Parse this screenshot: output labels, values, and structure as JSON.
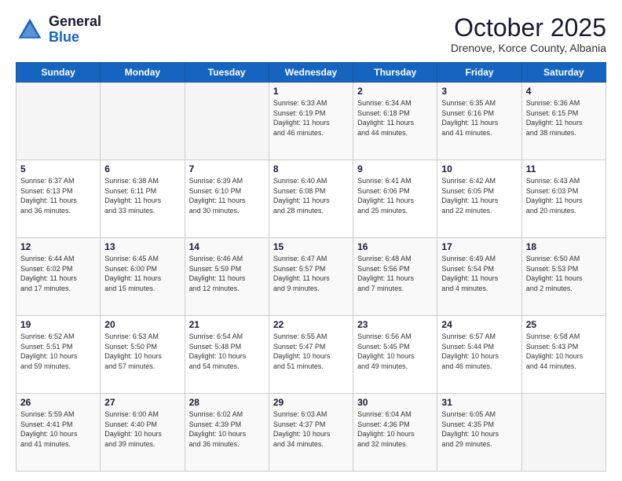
{
  "logo": {
    "general": "General",
    "blue": "Blue"
  },
  "title": "October 2025",
  "subtitle": "Drenove, Korce County, Albania",
  "weekdays": [
    "Sunday",
    "Monday",
    "Tuesday",
    "Wednesday",
    "Thursday",
    "Friday",
    "Saturday"
  ],
  "weeks": [
    [
      {
        "day": "",
        "info": ""
      },
      {
        "day": "",
        "info": ""
      },
      {
        "day": "",
        "info": ""
      },
      {
        "day": "1",
        "info": "Sunrise: 6:33 AM\nSunset: 6:19 PM\nDaylight: 11 hours\nand 46 minutes."
      },
      {
        "day": "2",
        "info": "Sunrise: 6:34 AM\nSunset: 6:18 PM\nDaylight: 11 hours\nand 44 minutes."
      },
      {
        "day": "3",
        "info": "Sunrise: 6:35 AM\nSunset: 6:16 PM\nDaylight: 11 hours\nand 41 minutes."
      },
      {
        "day": "4",
        "info": "Sunrise: 6:36 AM\nSunset: 6:15 PM\nDaylight: 11 hours\nand 38 minutes."
      }
    ],
    [
      {
        "day": "5",
        "info": "Sunrise: 6:37 AM\nSunset: 6:13 PM\nDaylight: 11 hours\nand 36 minutes."
      },
      {
        "day": "6",
        "info": "Sunrise: 6:38 AM\nSunset: 6:11 PM\nDaylight: 11 hours\nand 33 minutes."
      },
      {
        "day": "7",
        "info": "Sunrise: 6:39 AM\nSunset: 6:10 PM\nDaylight: 11 hours\nand 30 minutes."
      },
      {
        "day": "8",
        "info": "Sunrise: 6:40 AM\nSunset: 6:08 PM\nDaylight: 11 hours\nand 28 minutes."
      },
      {
        "day": "9",
        "info": "Sunrise: 6:41 AM\nSunset: 6:06 PM\nDaylight: 11 hours\nand 25 minutes."
      },
      {
        "day": "10",
        "info": "Sunrise: 6:42 AM\nSunset: 6:05 PM\nDaylight: 11 hours\nand 22 minutes."
      },
      {
        "day": "11",
        "info": "Sunrise: 6:43 AM\nSunset: 6:03 PM\nDaylight: 11 hours\nand 20 minutes."
      }
    ],
    [
      {
        "day": "12",
        "info": "Sunrise: 6:44 AM\nSunset: 6:02 PM\nDaylight: 11 hours\nand 17 minutes."
      },
      {
        "day": "13",
        "info": "Sunrise: 6:45 AM\nSunset: 6:00 PM\nDaylight: 11 hours\nand 15 minutes."
      },
      {
        "day": "14",
        "info": "Sunrise: 6:46 AM\nSunset: 5:59 PM\nDaylight: 11 hours\nand 12 minutes."
      },
      {
        "day": "15",
        "info": "Sunrise: 6:47 AM\nSunset: 5:57 PM\nDaylight: 11 hours\nand 9 minutes."
      },
      {
        "day": "16",
        "info": "Sunrise: 6:48 AM\nSunset: 5:56 PM\nDaylight: 11 hours\nand 7 minutes."
      },
      {
        "day": "17",
        "info": "Sunrise: 6:49 AM\nSunset: 5:54 PM\nDaylight: 11 hours\nand 4 minutes."
      },
      {
        "day": "18",
        "info": "Sunrise: 6:50 AM\nSunset: 5:53 PM\nDaylight: 11 hours\nand 2 minutes."
      }
    ],
    [
      {
        "day": "19",
        "info": "Sunrise: 6:52 AM\nSunset: 5:51 PM\nDaylight: 10 hours\nand 59 minutes."
      },
      {
        "day": "20",
        "info": "Sunrise: 6:53 AM\nSunset: 5:50 PM\nDaylight: 10 hours\nand 57 minutes."
      },
      {
        "day": "21",
        "info": "Sunrise: 6:54 AM\nSunset: 5:48 PM\nDaylight: 10 hours\nand 54 minutes."
      },
      {
        "day": "22",
        "info": "Sunrise: 6:55 AM\nSunset: 5:47 PM\nDaylight: 10 hours\nand 51 minutes."
      },
      {
        "day": "23",
        "info": "Sunrise: 6:56 AM\nSunset: 5:45 PM\nDaylight: 10 hours\nand 49 minutes."
      },
      {
        "day": "24",
        "info": "Sunrise: 6:57 AM\nSunset: 5:44 PM\nDaylight: 10 hours\nand 46 minutes."
      },
      {
        "day": "25",
        "info": "Sunrise: 6:58 AM\nSunset: 5:43 PM\nDaylight: 10 hours\nand 44 minutes."
      }
    ],
    [
      {
        "day": "26",
        "info": "Sunrise: 5:59 AM\nSunset: 4:41 PM\nDaylight: 10 hours\nand 41 minutes."
      },
      {
        "day": "27",
        "info": "Sunrise: 6:00 AM\nSunset: 4:40 PM\nDaylight: 10 hours\nand 39 minutes."
      },
      {
        "day": "28",
        "info": "Sunrise: 6:02 AM\nSunset: 4:39 PM\nDaylight: 10 hours\nand 36 minutes."
      },
      {
        "day": "29",
        "info": "Sunrise: 6:03 AM\nSunset: 4:37 PM\nDaylight: 10 hours\nand 34 minutes."
      },
      {
        "day": "30",
        "info": "Sunrise: 6:04 AM\nSunset: 4:36 PM\nDaylight: 10 hours\nand 32 minutes."
      },
      {
        "day": "31",
        "info": "Sunrise: 6:05 AM\nSunset: 4:35 PM\nDaylight: 10 hours\nand 29 minutes."
      },
      {
        "day": "",
        "info": ""
      }
    ]
  ]
}
